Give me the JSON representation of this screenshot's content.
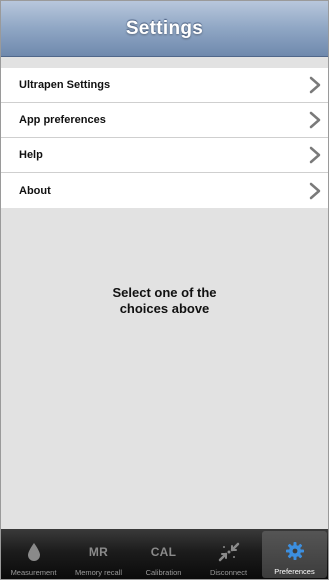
{
  "navbar": {
    "title": "Settings"
  },
  "menu": {
    "items": [
      {
        "label": "Ultrapen Settings"
      },
      {
        "label": "App preferences"
      },
      {
        "label": "Help"
      },
      {
        "label": "About"
      }
    ]
  },
  "content": {
    "message": "Select one of the\nchoices above"
  },
  "tabbar": {
    "selected": "Preferences",
    "tabs": [
      {
        "label": "Measurement",
        "icon": "water-drop-icon"
      },
      {
        "label": "Memory recall",
        "icon": "MR"
      },
      {
        "label": "Calibration",
        "icon": "CAL"
      },
      {
        "label": "Disconnect",
        "icon": "disconnect-arrows-icon"
      },
      {
        "label": "Preferences",
        "icon": "gear-icon"
      }
    ]
  },
  "colors": {
    "navbar": "#8fa6c4",
    "background": "#e2e2e2",
    "tabbar": "#1c1c1c",
    "selected_icon": "#3c8fe0"
  }
}
